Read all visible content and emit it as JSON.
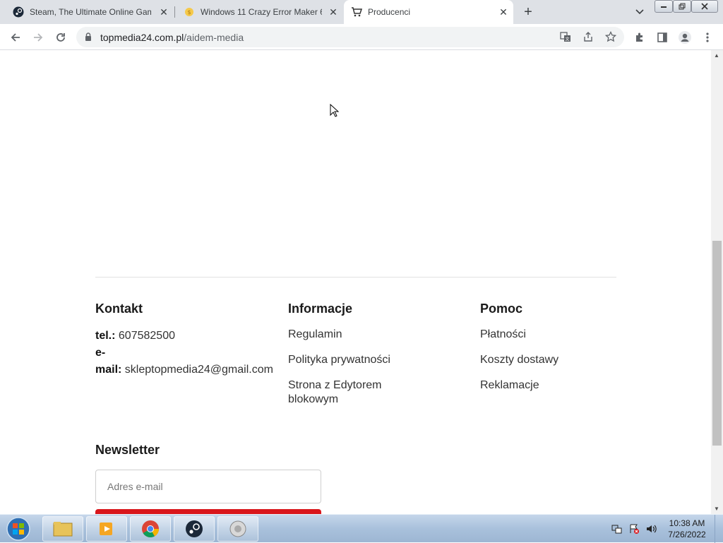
{
  "browser": {
    "tabs": [
      {
        "title": "Steam, The Ultimate Online Gam",
        "icon": "steam-icon",
        "active": false
      },
      {
        "title": "Windows 11 Crazy Error Maker 6",
        "icon": "coin-icon",
        "active": false
      },
      {
        "title": "Producenci",
        "icon": "cart-icon",
        "active": true
      }
    ],
    "new_tab_label": "+",
    "address": {
      "domain": "topmedia24.com.pl",
      "path": "/aidem-media"
    },
    "accent": "#dee1e6"
  },
  "footer": {
    "contact": {
      "title": "Kontakt",
      "tel_label": "tel.:",
      "tel_value": "607582500",
      "email_label_line1": "e-",
      "email_label_line2": "mail:",
      "email_value": "skleptopmedia24@gmail.com"
    },
    "info": {
      "title": "Informacje",
      "links": [
        "Regulamin",
        "Polityka prywatności",
        "Strona z Edytorem",
        "blokowym"
      ]
    },
    "help": {
      "title": "Pomoc",
      "links": [
        "Płatności",
        "Koszty dostawy",
        "Reklamacje"
      ]
    },
    "newsletter": {
      "title": "Newsletter",
      "placeholder": "Adres e-mail",
      "button_color": "#d9161b"
    }
  },
  "taskbar": {
    "time": "10:38 AM",
    "date": "7/26/2022"
  }
}
